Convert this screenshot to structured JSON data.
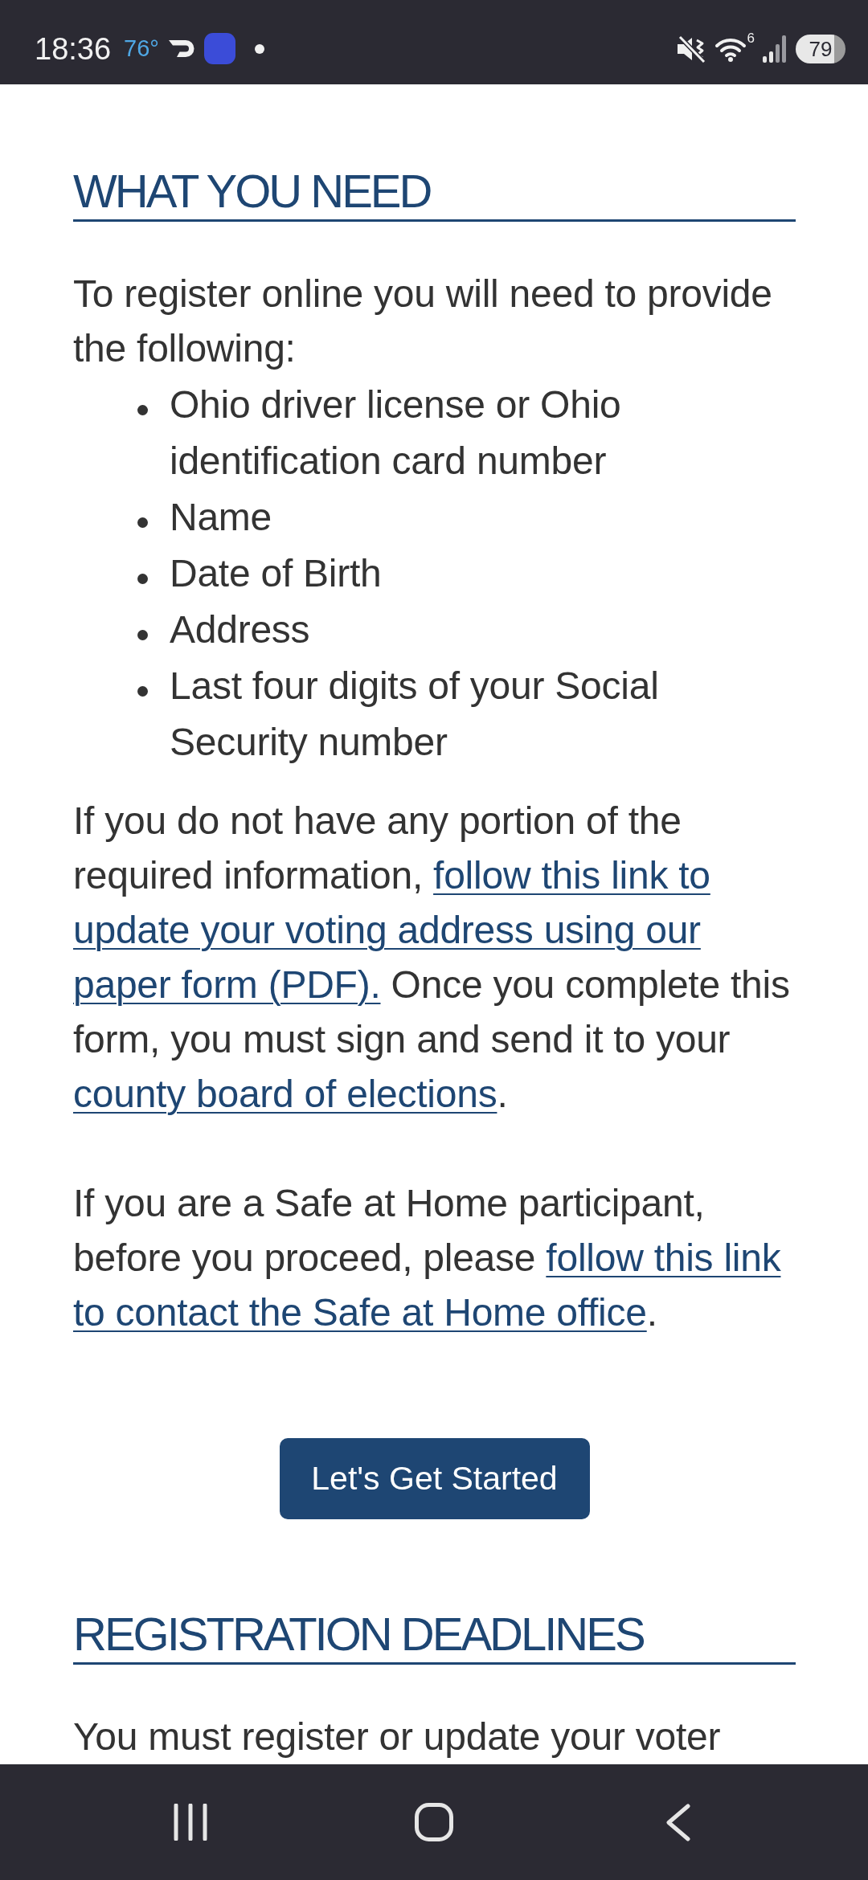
{
  "status_bar": {
    "time": "18:36",
    "temperature": "76°",
    "wifi_label": "6",
    "battery": "79"
  },
  "sections": [
    {
      "heading": "WHAT YOU NEED",
      "blocks": [
        {
          "kind": "paragraph",
          "parts": [
            {
              "kind": "text",
              "text": "To register online you will need to provide the following:"
            }
          ]
        },
        {
          "kind": "list",
          "items": [
            "Ohio driver license or Ohio identification card number",
            "Name",
            "Date of Birth",
            "Address",
            "Last four digits of your Social Security number"
          ]
        },
        {
          "kind": "paragraph",
          "parts": [
            {
              "kind": "text",
              "text": "If you do not have any portion of the required information,"
            },
            {
              "kind": "link",
              "text": "follow this link to"
            },
            {
              "kind": "link",
              "text": "update your voting address using our"
            },
            {
              "kind": "link",
              "text": "paper form (PDF)."
            },
            {
              "kind": "text",
              "text": "Once you complete this form, you must sign and send it to your"
            },
            {
              "kind": "link",
              "text": "county board of elections",
              "suffix": "."
            }
          ]
        },
        {
          "kind": "paragraph",
          "parts": [
            {
              "kind": "text",
              "text": "If you are a Safe at Home participant, before you proceed, please"
            },
            {
              "kind": "link",
              "text": "follow this link"
            },
            {
              "kind": "link",
              "text": "to contact the Safe at Home office",
              "suffix": "."
            }
          ]
        },
        {
          "kind": "button",
          "label": "Let's Get Started"
        }
      ]
    },
    {
      "heading": "REGISTRATION DEADLINES",
      "blocks": [
        {
          "kind": "paragraph",
          "parts": [
            {
              "kind": "text",
              "text": "You must register or update your voter"
            }
          ]
        }
      ]
    }
  ]
}
